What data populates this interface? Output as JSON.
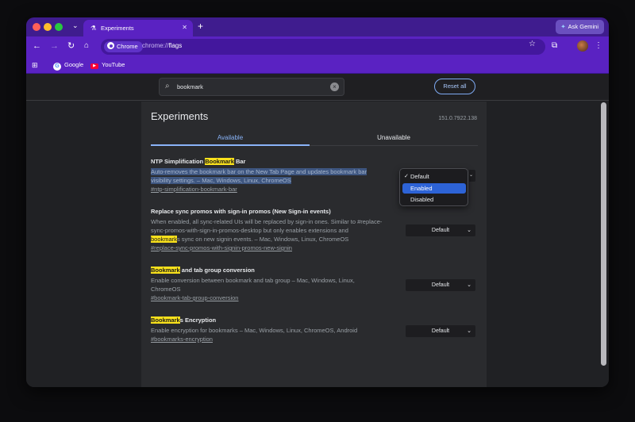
{
  "browser": {
    "tab_title": "Experiments",
    "ask_gemini": "Ask Gemini",
    "chip_label": "Chrome",
    "url_scheme": "chrome://",
    "url_path": "flags",
    "bookmarks": [
      {
        "label": "Google"
      },
      {
        "label": "YouTube"
      }
    ]
  },
  "search": {
    "value": "bookmark",
    "reset_label": "Reset all"
  },
  "page": {
    "title": "Experiments",
    "version": "151.0.7922.138",
    "tabs": [
      "Available",
      "Unavailable"
    ]
  },
  "experiments": [
    {
      "title_pre": "NTP Simplification ",
      "title_hl": "Bookmark",
      "title_post": " Bar",
      "desc_lines": [
        "Auto-removes the bookmark bar on the New Tab Page and updates bookmark bar",
        "visibility settings. – Mac, Windows, Linux, ChromeOS"
      ],
      "link": "#ntp-simplification-bookmark-bar",
      "select": "Default"
    },
    {
      "title": "Replace sync promos with sign-in promos (New Sign-in events)",
      "desc_lines": [
        "When enabled, all sync-related UIs will be replaced by sign-in ones. Similar to #replace-",
        "sync-promos-with-sign-in-promos-desktop but only enables extensions and"
      ],
      "desc_hl": "bookmark",
      "desc_post": "s sync on new signin events. – Mac, Windows, Linux, ChromeOS",
      "link": "#replace-sync-promos-with-signin-promos-new-signin",
      "select": "Default"
    },
    {
      "title_hl": "Bookmark",
      "title_post": " and tab group conversion",
      "desc_lines": [
        "Enable conversion between bookmark and tab group – Mac, Windows, Linux,",
        "ChromeOS"
      ],
      "link": "#bookmark-tab-group-conversion",
      "select": "Default"
    },
    {
      "title_hl": "Bookmark",
      "title_post": "s Encryption",
      "desc_lines": [
        "Enable encryption for bookmarks – Mac, Windows, Linux, ChromeOS, Android"
      ],
      "link": "#bookmarks-encryption",
      "select": "Default"
    }
  ],
  "dropdown": {
    "options": [
      "Default",
      "Enabled",
      "Disabled"
    ],
    "checked": "Default",
    "highlighted": "Enabled"
  },
  "colors": {
    "tab_strip": "#3f1c8e",
    "toolbar": "#5a22c2",
    "highlight": "#f9e11c",
    "accent": "#8ab4f8"
  }
}
